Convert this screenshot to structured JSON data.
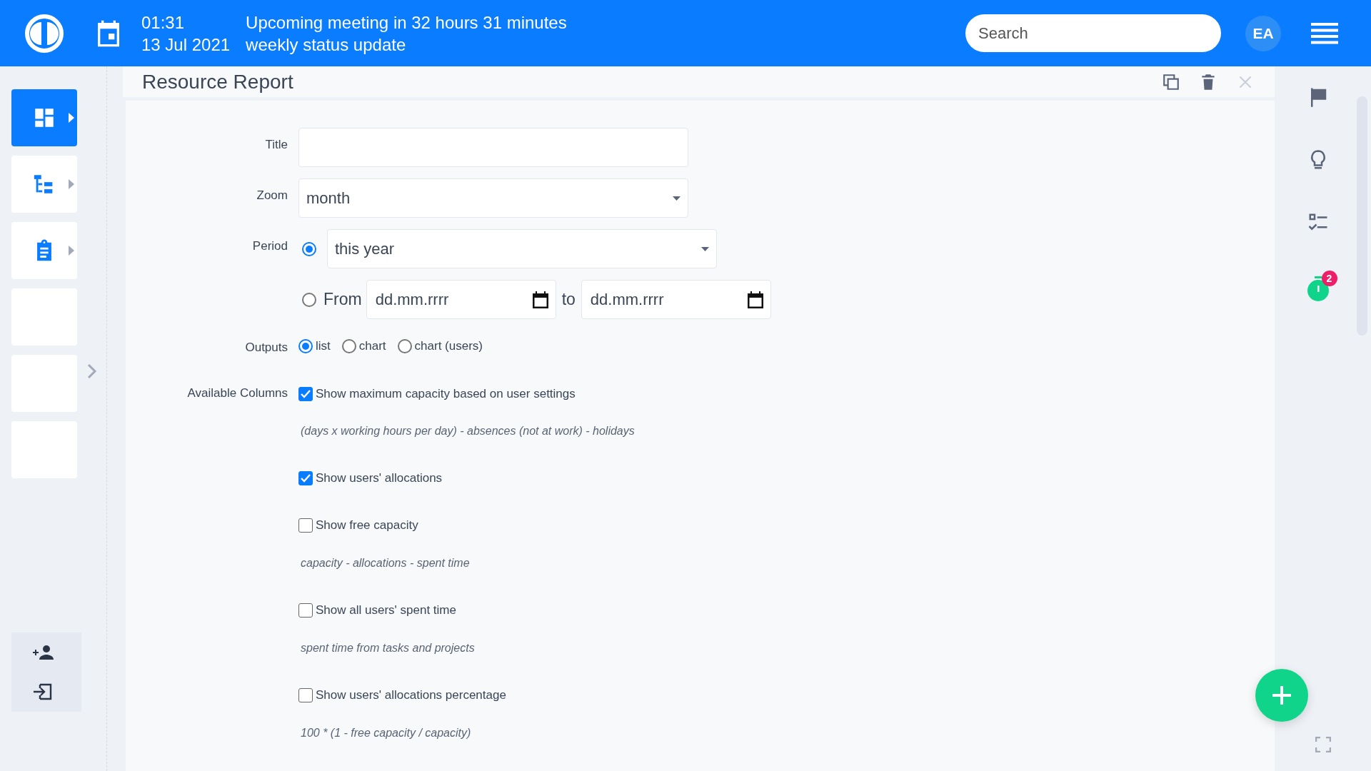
{
  "topbar": {
    "time": "01:31",
    "meeting": "Upcoming meeting in 32 hours 31 minutes",
    "date": "13 Jul 2021",
    "meeting_title": "weekly status update",
    "search": {
      "placeholder": "Search"
    },
    "avatar": "EA"
  },
  "sidebar": {
    "items": [
      {
        "kind": "dashboard",
        "selected": true,
        "expandable": true
      },
      {
        "kind": "tree",
        "selected": false,
        "expandable": true
      },
      {
        "kind": "clipboard",
        "selected": false,
        "expandable": true
      },
      {
        "kind": "blank",
        "selected": false,
        "expandable": false
      },
      {
        "kind": "blank",
        "selected": false,
        "expandable": false
      },
      {
        "kind": "blank",
        "selected": false,
        "expandable": false
      }
    ]
  },
  "panel": {
    "title": "Resource Report"
  },
  "form": {
    "title_field": {
      "label": "Title"
    },
    "zoom": {
      "label": "Zoom",
      "value": "month"
    },
    "period": {
      "label": "Period",
      "options": [
        {
          "kind": "preset",
          "selected": true,
          "value": "this year"
        },
        {
          "kind": "range",
          "selected": false,
          "label": "From",
          "from_placeholder": "dd.mm.rrrr",
          "to_label": "to",
          "to_placeholder": "dd.mm.rrrr"
        }
      ]
    },
    "outputs": {
      "label": "Outputs",
      "options": [
        {
          "label": "list",
          "selected": true
        },
        {
          "label": "chart",
          "selected": false
        },
        {
          "label": "chart (users)",
          "selected": false
        }
      ]
    },
    "columns": {
      "label": "Available Columns",
      "items": [
        {
          "label": "Show maximum capacity based on user settings",
          "checked": true,
          "note": "(days x working hours per day) - absences (not at work) - holidays"
        },
        {
          "label": "Show users' allocations",
          "checked": true
        },
        {
          "label": "Show free capacity",
          "checked": false,
          "note": "capacity - allocations - spent time"
        },
        {
          "label": "Show all users' spent time",
          "checked": false,
          "note": "spent time from tasks and projects"
        },
        {
          "label": "Show users' allocations percentage",
          "checked": false,
          "note": "100 * (1 - free capacity / capacity)"
        }
      ]
    }
  },
  "right_sidebar": {
    "timer_badge": "2"
  }
}
